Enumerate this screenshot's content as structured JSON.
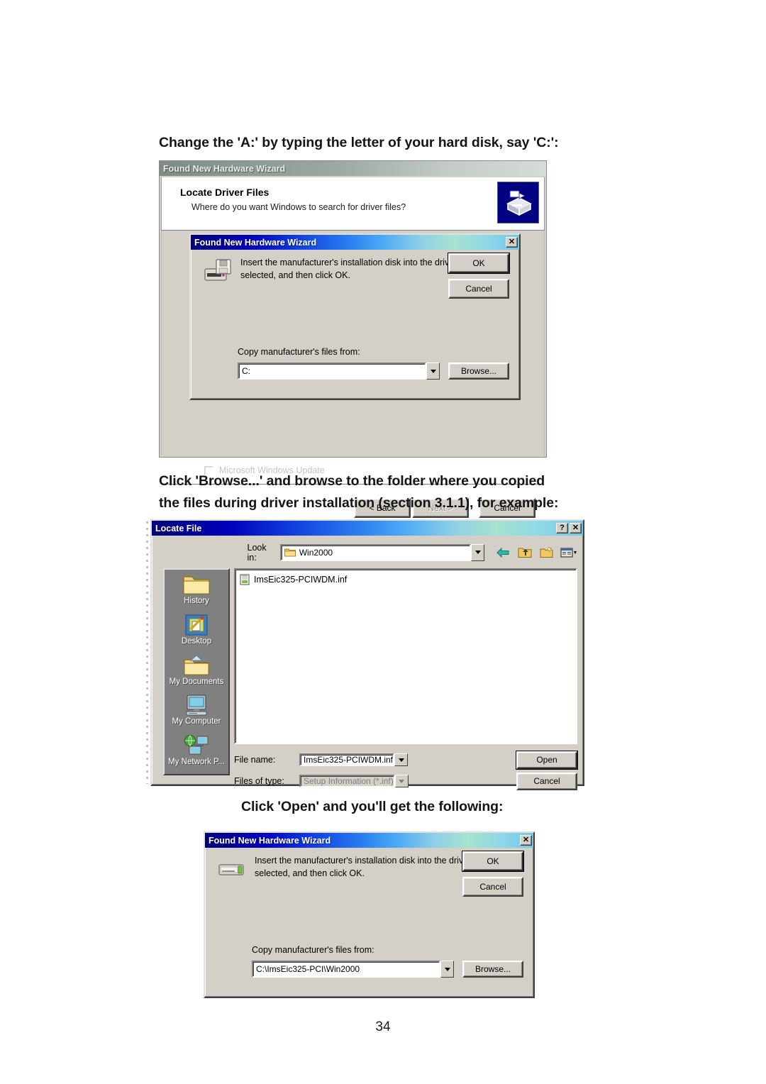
{
  "page": {
    "number": "34"
  },
  "headings": {
    "step1": "Change the 'A:' by typing the letter of your hard disk, say 'C:':",
    "step2_line1": "Click 'Browse...' and browse to the folder where you copied",
    "step2_line2": "the files during driver installation (section 3.1.1), for example:",
    "step3": "Click 'Open' and you'll get the following:"
  },
  "wizard": {
    "titlebar": "Found New Hardware Wizard",
    "header_title": "Locate Driver Files",
    "header_subtitle": "Where do you want Windows to search for driver files?",
    "header_icon": "hardware-wizard-icon",
    "ghost_option": "Microsoft Windows Update",
    "buttons": {
      "back": "< Back",
      "next": "Next >",
      "cancel": "Cancel"
    }
  },
  "msgbox1": {
    "titlebar": "Found New Hardware Wizard",
    "close_label": "✕",
    "icon": "floppy-drive-icon",
    "message": "Insert the manufacturer's installation disk into the drive selected, and then click OK.",
    "ok_label": "OK",
    "cancel_label": "Cancel",
    "copy_label": "Copy manufacturer's files from:",
    "path_value": "C:",
    "browse_label": "Browse..."
  },
  "msgbox2": {
    "titlebar": "Found New Hardware Wizard",
    "close_label": "✕",
    "icon": "hard-drive-icon",
    "message": "Insert the manufacturer's installation disk into the drive selected, and then click OK.",
    "ok_label": "OK",
    "cancel_label": "Cancel",
    "copy_label": "Copy manufacturer's files from:",
    "path_value": "C:\\ImsEic325-PCI\\Win2000",
    "browse_label": "Browse..."
  },
  "locate_file": {
    "titlebar": "Locate File",
    "help_label": "?",
    "close_label": "✕",
    "look_in_label": "Look in:",
    "look_in_value": "Win2000",
    "toolbar_icons": [
      "back-arrow-icon",
      "up-one-level-icon",
      "new-folder-icon",
      "views-icon"
    ],
    "places": [
      {
        "label": "History",
        "icon": "history-folder-icon"
      },
      {
        "label": "Desktop",
        "icon": "desktop-icon"
      },
      {
        "label": "My Documents",
        "icon": "my-documents-icon"
      },
      {
        "label": "My Computer",
        "icon": "my-computer-icon"
      },
      {
        "label": "My Network P...",
        "icon": "my-network-places-icon"
      }
    ],
    "files": [
      {
        "name": "ImsEic325-PCIWDM.inf",
        "icon": "inf-file-icon"
      }
    ],
    "file_name_label": "File name:",
    "file_name_value": "ImsEic325-PCIWDM.inf",
    "files_of_type_label": "Files of type:",
    "files_of_type_value": "Setup Information (*.inf)",
    "open_label": "Open",
    "cancel_label": "Cancel"
  },
  "colors": {
    "window_face": "#d4d0c8",
    "title_active_start": "#00007a",
    "title_inactive": "#7d8d85",
    "places_bar": "#808080",
    "wizard_icon_bg": "#000080"
  }
}
